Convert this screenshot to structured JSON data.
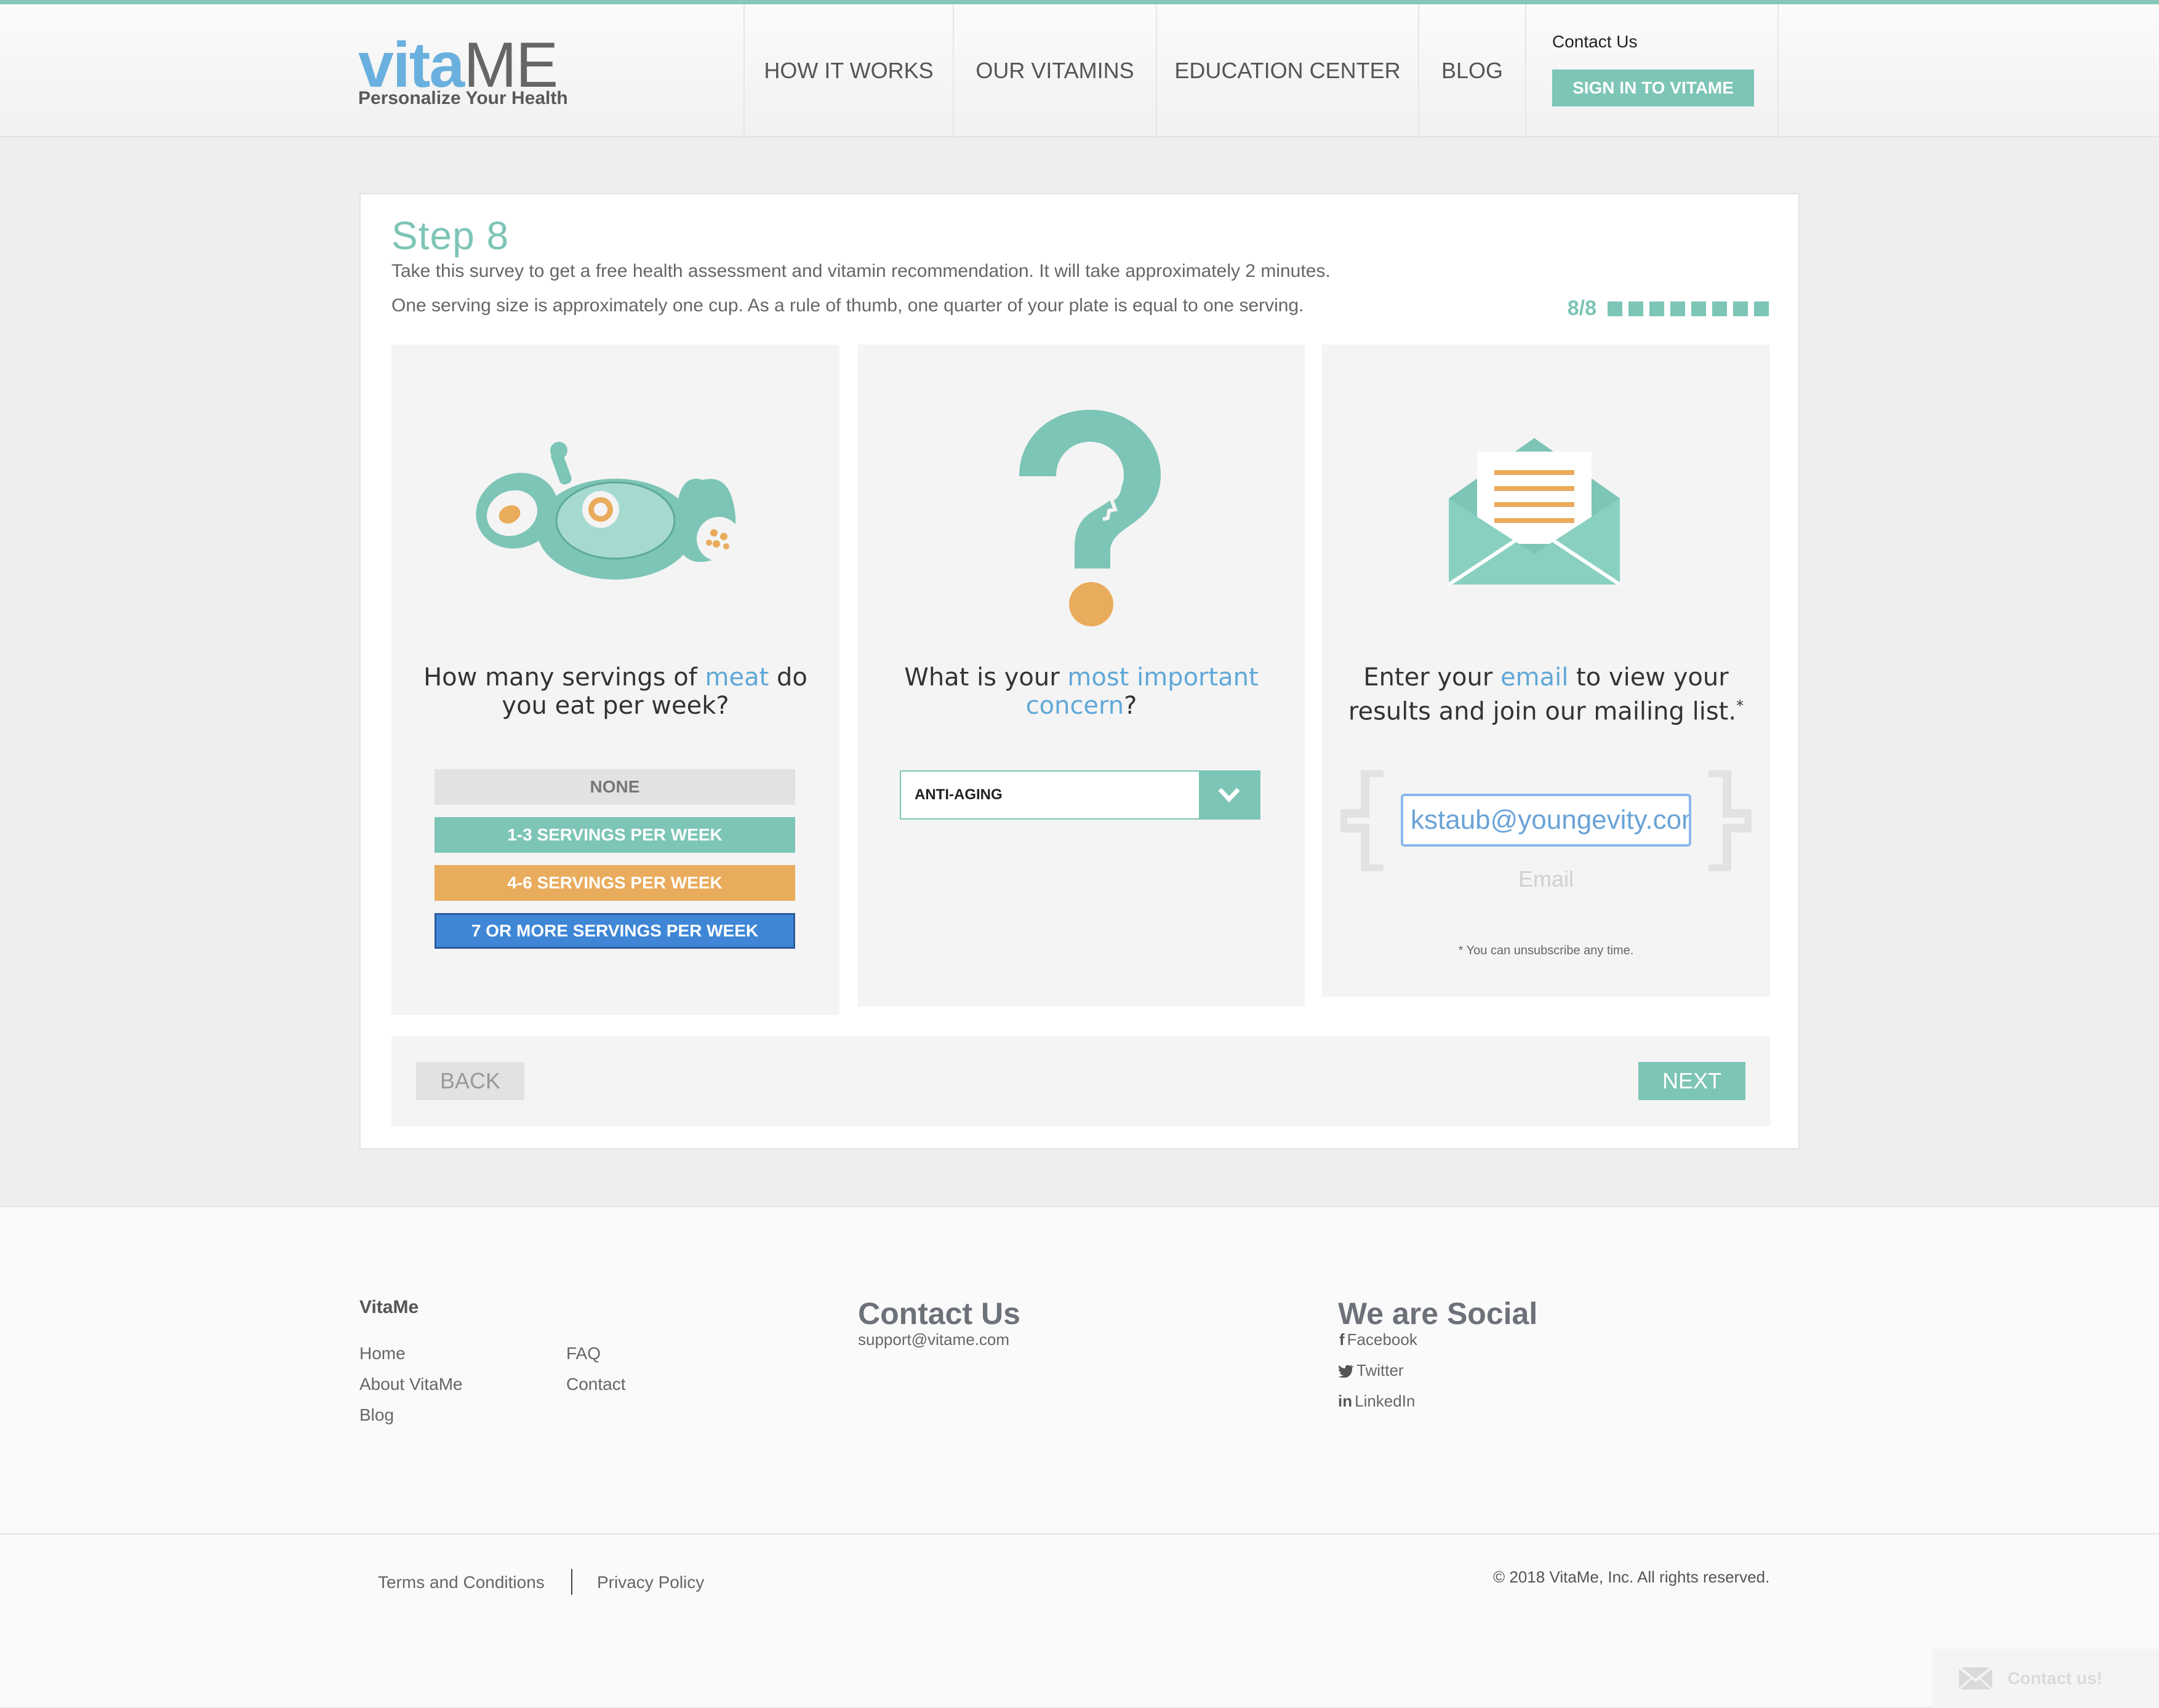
{
  "header": {
    "logo_vita": "vita",
    "logo_me": "ME",
    "tagline": "Personalize Your Health",
    "nav": [
      "HOW IT WORKS",
      "OUR VITAMINS",
      "EDUCATION CENTER",
      "BLOG"
    ],
    "contact_label": "Contact Us",
    "signin_label": "SIGN IN TO VITAME"
  },
  "survey": {
    "step_title": "Step 8",
    "intro_line1": "Take this survey to get a free health assessment and vitamin recommendation. It will take approximately 2 minutes.",
    "intro_line2": "One serving size is approximately one cup. As a rule of thumb, one quarter of your plate is equal to one serving.",
    "progress_text": "8/8",
    "progress_current": 8,
    "progress_total": 8,
    "meat_question": {
      "before": "How many servings of ",
      "highlight": "meat",
      "after": " do you eat per week?"
    },
    "meat_options": [
      "NONE",
      "1-3 SERVINGS PER WEEK",
      "4-6 SERVINGS PER WEEK",
      "7 OR MORE SERVINGS PER WEEK"
    ],
    "meat_selected": "7 OR MORE SERVINGS PER WEEK",
    "concern_question": {
      "before": "What is your ",
      "highlight": "most important concern",
      "after": "?"
    },
    "concern_value": "ANTI-AGING",
    "email_question": {
      "before": "Enter your ",
      "highlight": "email",
      "after": " to view your results and join our mailing list.",
      "asterisk": "*"
    },
    "email_value": "kstaub@youngevity.com",
    "email_label": "Email",
    "unsubscribe_note": "* You can unsubscribe any time.",
    "back_label": "BACK",
    "next_label": "NEXT"
  },
  "footer": {
    "brand": "VitaMe",
    "links_col1": [
      "Home",
      "About VitaMe",
      "Blog"
    ],
    "links_col2": [
      "FAQ",
      "Contact"
    ],
    "contact_heading": "Contact Us",
    "contact_email": "support@vitame.com",
    "social_heading": "We are Social",
    "social": [
      "Facebook",
      "Twitter",
      "LinkedIn"
    ],
    "terms": "Terms and Conditions",
    "privacy": "Privacy Policy",
    "copyright": "© 2018 VitaMe, Inc. All rights reserved.",
    "contact_widget": "Contact us!"
  },
  "colors": {
    "teal": "#7dc5b6",
    "orange": "#e9ab5c",
    "blue": "#3f87d6",
    "link_blue": "#5fa8d8"
  }
}
